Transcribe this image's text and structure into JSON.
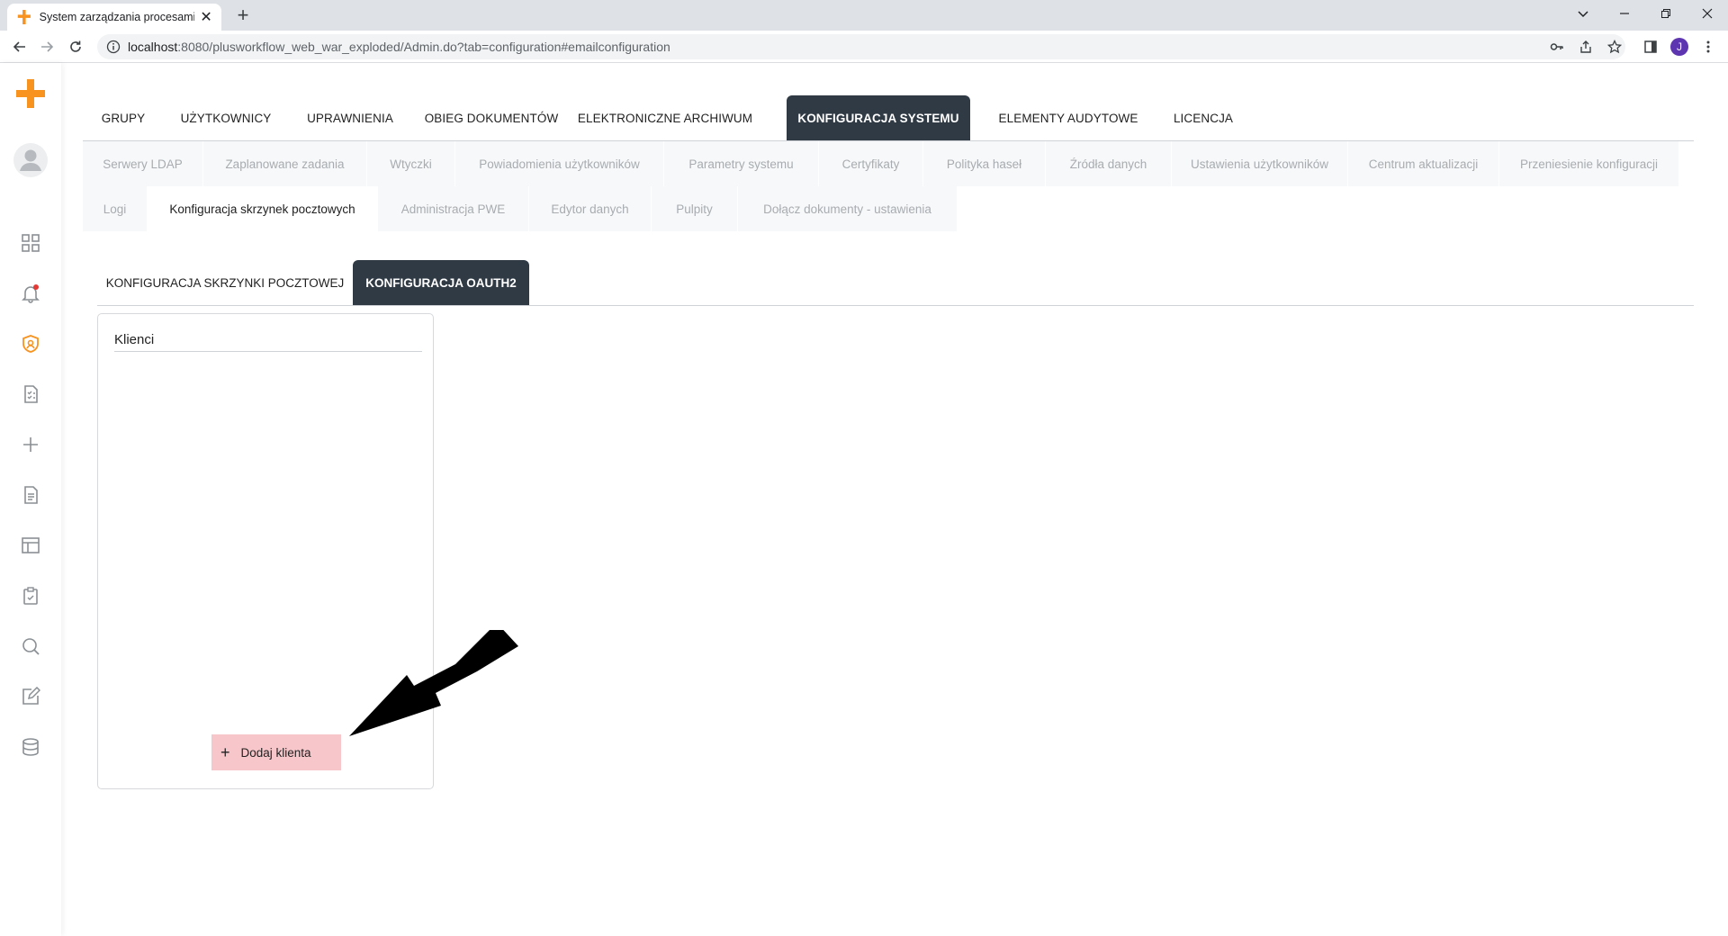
{
  "browser": {
    "tab_title": "System zarządzania procesami bi",
    "url_host": "localhost",
    "url_rest": ":8080/plusworkflow_web_war_exploded/Admin.do?tab=configuration#emailconfiguration",
    "profile_initial": "J"
  },
  "brand": {
    "accent": "#f7931e",
    "dark_tab": "#2f3a45",
    "add_button_bg": "#f7c6ca"
  },
  "sidebar": {
    "items": [
      {
        "icon": "dashboard-grid-icon"
      },
      {
        "icon": "notifications-bell-icon"
      },
      {
        "icon": "admin-shield-icon"
      },
      {
        "icon": "tasks-list-icon"
      },
      {
        "icon": "new-plus-icon"
      },
      {
        "icon": "document-icon"
      },
      {
        "icon": "table-layout-icon"
      },
      {
        "icon": "clipboard-icon"
      },
      {
        "icon": "search-icon"
      },
      {
        "icon": "edit-icon"
      },
      {
        "icon": "database-icon"
      }
    ]
  },
  "main_tabs": [
    {
      "label": "GRUPY"
    },
    {
      "label": "UŻYTKOWNICY"
    },
    {
      "label": "UPRAWNIENIA"
    },
    {
      "label": "OBIEG DOKUMENTÓW"
    },
    {
      "label": "ELEKTRONICZNE ARCHIWUM"
    },
    {
      "label": "KONFIGURACJA SYSTEMU"
    },
    {
      "label": "ELEMENTY AUDYTOWE"
    },
    {
      "label": "LICENCJA"
    }
  ],
  "sub_tabs": [
    {
      "label": "Serwery LDAP"
    },
    {
      "label": "Zaplanowane zadania"
    },
    {
      "label": "Wtyczki"
    },
    {
      "label": "Powiadomienia użytkowników"
    },
    {
      "label": "Parametry systemu"
    },
    {
      "label": "Certyfikaty"
    },
    {
      "label": "Polityka haseł"
    },
    {
      "label": "Źródła danych"
    },
    {
      "label": "Ustawienia użytkowników"
    },
    {
      "label": "Centrum aktualizacji"
    },
    {
      "label": "Przeniesienie konfiguracji"
    },
    {
      "label": "Logi"
    },
    {
      "label": "Konfiguracja skrzynek pocztowych"
    },
    {
      "label": "Administracja PWE"
    },
    {
      "label": "Edytor danych"
    },
    {
      "label": "Pulpity"
    },
    {
      "label": "Dołącz dokumenty - ustawienia"
    }
  ],
  "inner_tabs": [
    {
      "label": "KONFIGURACJA SKRZYNKI POCZTOWEJ"
    },
    {
      "label": "KONFIGURACJA OAUTH2"
    }
  ],
  "clients_panel": {
    "title": "Klienci",
    "add_button": "Dodaj klienta"
  }
}
